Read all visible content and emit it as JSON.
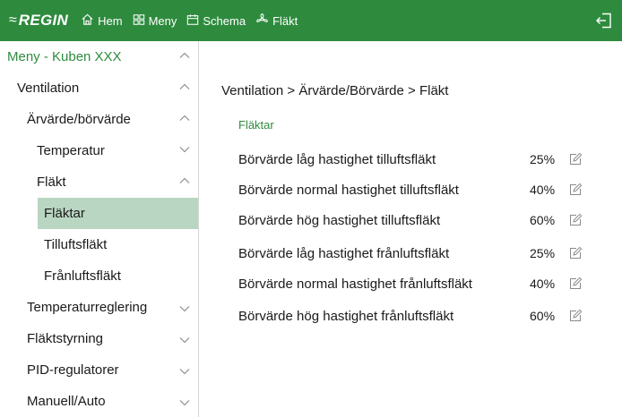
{
  "topbar": {
    "brand": "REGIN",
    "nav": [
      {
        "label": "Hem",
        "icon": "home-icon"
      },
      {
        "label": "Meny",
        "icon": "grid-icon"
      },
      {
        "label": "Schema",
        "icon": "calendar-icon"
      },
      {
        "label": "Fläkt",
        "icon": "fan-icon"
      }
    ],
    "exit_icon": "logout-icon",
    "colors": {
      "bar": "#2e8b3e",
      "text": "#ffffff"
    }
  },
  "sidebar": {
    "title": "Meny - Kuben XXX",
    "items": [
      {
        "label": "Ventilation",
        "chevron": "up"
      },
      {
        "label": "Ärvärde/börvärde",
        "chevron": "up"
      },
      {
        "label": "Temperatur",
        "chevron": "down"
      },
      {
        "label": "Fläkt",
        "chevron": "up"
      },
      {
        "label": "Fläktar",
        "chevron": "none",
        "selected": true
      },
      {
        "label": "Tilluftsfläkt",
        "chevron": "none"
      },
      {
        "label": "Frånluftsfläkt",
        "chevron": "none"
      },
      {
        "label": "Temperaturreglering",
        "chevron": "down"
      },
      {
        "label": "Fläktstyrning",
        "chevron": "down"
      },
      {
        "label": "PID-regulatorer",
        "chevron": "down"
      },
      {
        "label": "Manuell/Auto",
        "chevron": "down"
      }
    ],
    "colors": {
      "selected_bg": "#b9d6c2",
      "title": "#2e8b3e"
    }
  },
  "main": {
    "breadcrumb": "Ventilation > Ärvärde/Börvärde > Fläkt",
    "section_title": "Fläktar",
    "rows": [
      {
        "label": "Börvärde låg hastighet tilluftsfläkt",
        "value": "25%"
      },
      {
        "label": "Börvärde normal hastighet tilluftsfläkt",
        "value": "40%"
      },
      {
        "label": "Börvärde hög hastighet tilluftsfläkt",
        "value": "60%"
      },
      {
        "label": "Börvärde låg hastighet frånluftsfläkt",
        "value": "25%"
      },
      {
        "label": "Börvärde normal hastighet frånluftsfläkt",
        "value": "40%"
      },
      {
        "label": "Börvärde hög hastighet frånluftsfläkt",
        "value": "60%"
      }
    ]
  }
}
